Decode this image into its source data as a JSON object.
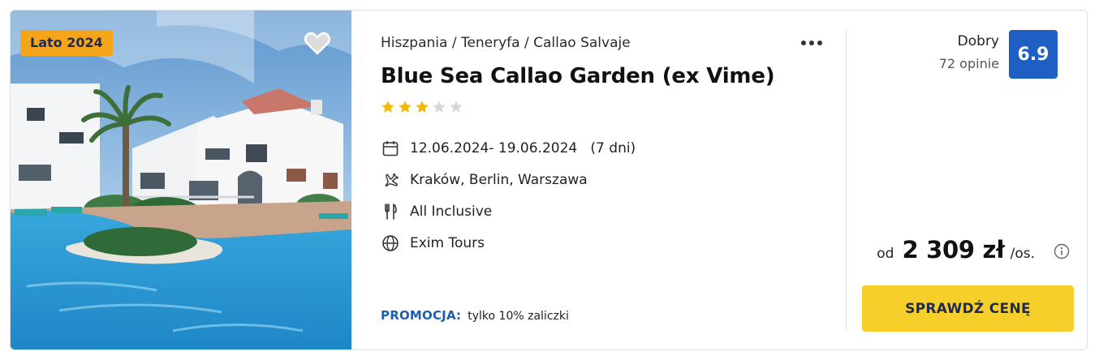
{
  "offer": {
    "season_badge": "Lato 2024",
    "breadcrumb": "Hiszpania / Teneryfa / Callao Salvaje",
    "hotel_name": "Blue Sea Callao Garden (ex Vime)",
    "stars": {
      "filled": 3,
      "total": 5
    },
    "details": {
      "dates": "12.06.2024- 19.06.2024   (7 dni)",
      "departure": "Kraków, Berlin, Warszawa",
      "board": "All Inclusive",
      "operator": "Exim Tours"
    },
    "promo": {
      "label": "PROMOCJA:",
      "text": "tylko 10% zaliczki"
    },
    "rating": {
      "word": "Dobry",
      "reviews": "72 opinie",
      "score": "6.9"
    },
    "price": {
      "prefix": "od",
      "value": "2 309 zł",
      "suffix": "/os."
    },
    "cta_label": "SPRAWDŹ CENĘ",
    "icons": {
      "favorite": "heart-icon",
      "more": "more-dots-icon",
      "dates": "calendar-icon",
      "departure": "plane-icon",
      "board": "cutlery-icon",
      "operator": "globe-icon",
      "price_info": "info-icon"
    },
    "colors": {
      "badge": "#f4a51c",
      "rating_badge": "#1f5fc4",
      "cta": "#f6cf2b",
      "promo": "#1f5fb0",
      "star_filled": "#f5b800",
      "star_empty": "#d5d8dd"
    }
  }
}
